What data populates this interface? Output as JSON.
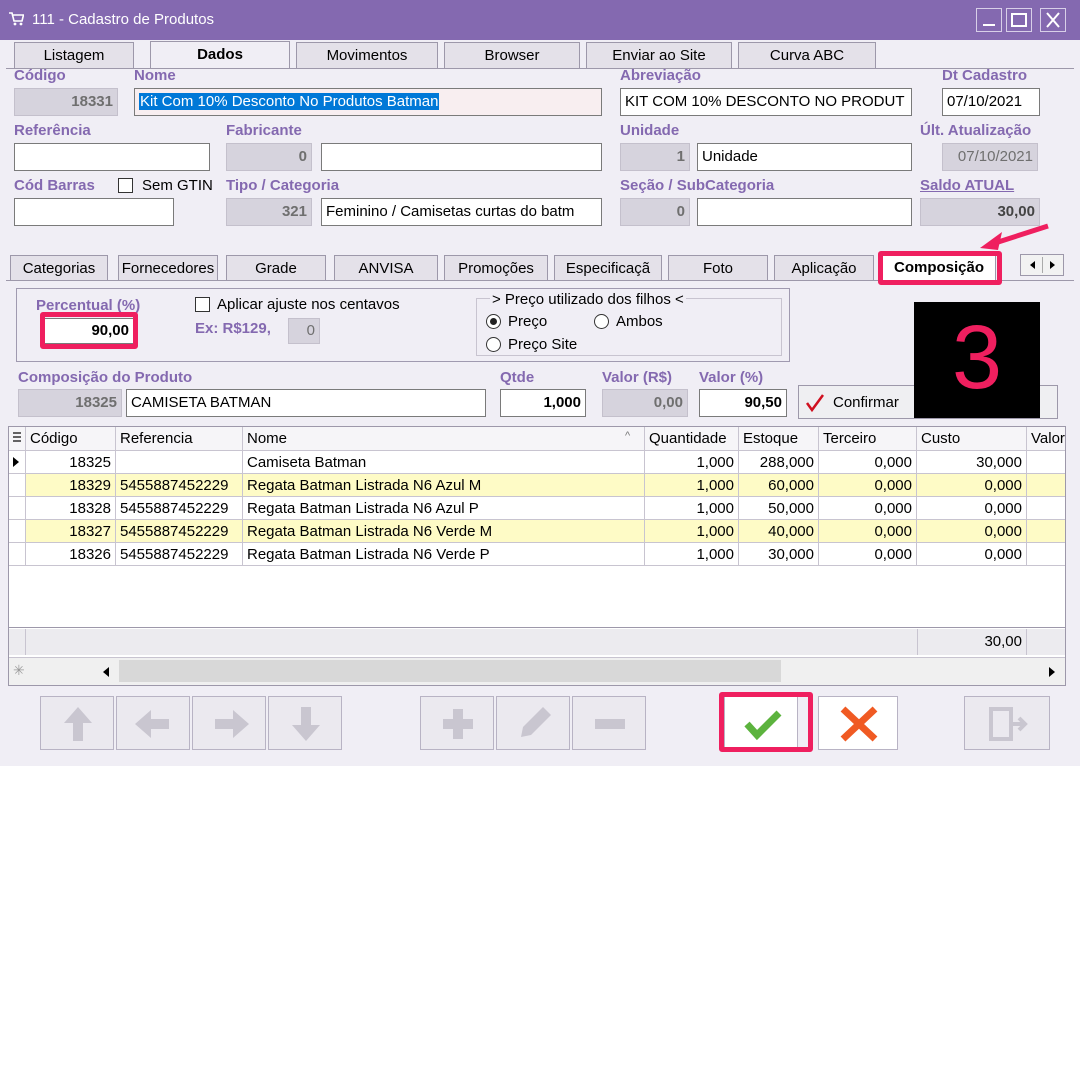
{
  "window": {
    "title": "111 - Cadastro de Produtos"
  },
  "main_tabs": [
    "Listagem",
    "Dados",
    "Movimentos",
    "Browser",
    "Enviar ao Site",
    "Curva ABC"
  ],
  "form": {
    "codigo_label": "Código",
    "codigo_value": "18331",
    "nome_label": "Nome",
    "nome_value": "Kit Com 10% Desconto No Produtos Batman",
    "abreviacao_label": "Abreviação",
    "abreviacao_value": "KIT COM 10% DESCONTO NO PRODUT",
    "dt_cadastro_label": "Dt Cadastro",
    "dt_cadastro_value": "07/10/2021",
    "referencia_label": "Referência",
    "referencia_value": "",
    "fabricante_label": "Fabricante",
    "fabricante_code": "0",
    "fabricante_value": "",
    "unidade_label": "Unidade",
    "unidade_code": "1",
    "unidade_value": "Unidade",
    "ult_atualizacao_label": "Últ. Atualização",
    "ult_atualizacao_value": "07/10/2021",
    "cod_barras_label": "Cód Barras",
    "cod_barras_value": "",
    "sem_gtin_label": "Sem GTIN",
    "tipo_label": "Tipo / Categoria",
    "tipo_code": "321",
    "tipo_value": "Feminino / Camisetas curtas do batm",
    "secao_label": "Seção / SubCategoria",
    "secao_code": "0",
    "secao_value": "",
    "saldo_label": "Saldo ATUAL",
    "saldo_value": "30,00"
  },
  "sub_tabs": [
    "Categorias",
    "Fornecedores",
    "Grade",
    "ANVISA",
    "Promoções",
    "Especificaçã",
    "Foto",
    "Aplicação",
    "Composição"
  ],
  "composicao": {
    "percentual_label": "Percentual (%)",
    "percentual_value": "90,00",
    "ajuste_label": "Aplicar ajuste nos centavos",
    "ex_label": "Ex: R$129,",
    "ex_value": "0",
    "preco_group_label": "> Preço utilizado dos filhos <",
    "radio_preco": "Preço",
    "radio_ambos": "Ambos",
    "radio_preco_site": "Preço Site",
    "comp_produto_label": "Composição do Produto",
    "comp_code": "18325",
    "comp_name": "CAMISETA BATMAN",
    "qtde_label": "Qtde",
    "qtde_value": "1,000",
    "valor_rs_label": "Valor (R$)",
    "valor_rs_value": "0,00",
    "valor_pct_label": "Valor (%)",
    "valor_pct_value": "90,50",
    "confirmar_label": "Confirmar",
    "cut_button_tail": "r"
  },
  "annotation_number": "3",
  "grid": {
    "headers": [
      "Código",
      "Referencia",
      "Nome",
      "Quantidade",
      "Estoque",
      "Terceiro",
      "Custo",
      "Valor"
    ],
    "rows": [
      [
        "18325",
        "",
        "Camiseta Batman",
        "1,000",
        "288,000",
        "0,000",
        "30,000"
      ],
      [
        "18329",
        "5455887452229",
        "Regata Batman Listrada N6 Azul M",
        "1,000",
        "60,000",
        "0,000",
        "0,000"
      ],
      [
        "18328",
        "5455887452229",
        "Regata Batman Listrada N6 Azul P",
        "1,000",
        "50,000",
        "0,000",
        "0,000"
      ],
      [
        "18327",
        "5455887452229",
        "Regata Batman Listrada N6 Verde M",
        "1,000",
        "40,000",
        "0,000",
        "0,000"
      ],
      [
        "18326",
        "5455887452229",
        "Regata Batman Listrada N6 Verde P",
        "1,000",
        "30,000",
        "0,000",
        "0,000"
      ]
    ],
    "footer_total": "30,00"
  },
  "colors": {
    "title_bar": "#8469b0",
    "label": "#8469b0",
    "highlight": "#ef1f5f",
    "row_alt": "#fefbc6"
  }
}
